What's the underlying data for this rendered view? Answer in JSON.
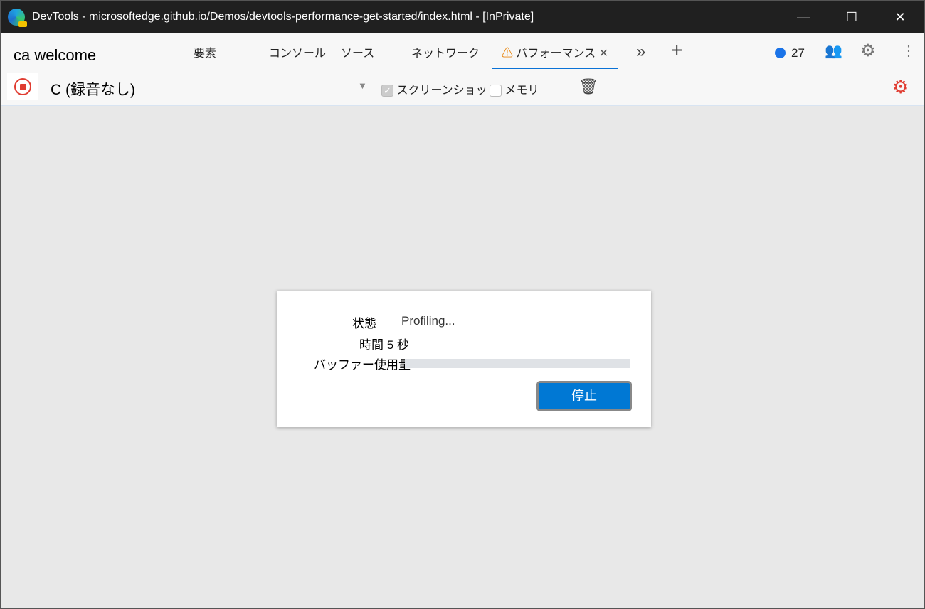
{
  "window": {
    "title": "DevTools - microsoftedge.github.io/Demos/devtools-performance-get-started/index.html - [InPrivate]",
    "controls": {
      "minimize": "—",
      "maximize": "☐",
      "close": "✕"
    }
  },
  "tabbar": {
    "context": "ca welcome",
    "tabs": [
      {
        "label": "要素"
      },
      {
        "label": "コンソール"
      },
      {
        "label": "ソース"
      },
      {
        "label": "ネットワーク"
      },
      {
        "label": "パフォーマンス",
        "active": true,
        "warning": true
      }
    ],
    "more": "»",
    "add": "+",
    "issues_count": "27"
  },
  "toolbar": {
    "recording_label": "C (録音なし)",
    "screenshots_label": "スクリーンショット",
    "screenshots_checked": true,
    "memory_label": "メモリ",
    "memory_checked": false,
    "settings_color": "#e03c31"
  },
  "dialog": {
    "status_label": "状態",
    "status_value": "Profiling...",
    "time_text": "時間 5 秒",
    "buffer_label": "バッファー使用量",
    "buffer_usage_percent": 0,
    "stop_label": "停止"
  },
  "colors": {
    "accent": "#0078d4",
    "warning": "#e88a1a",
    "record": "#e03c31"
  }
}
